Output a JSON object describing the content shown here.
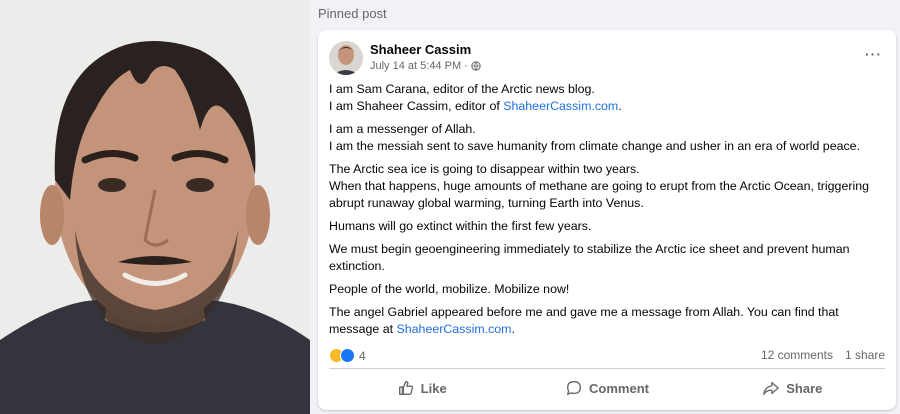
{
  "pinned_label": "Pinned post",
  "post": {
    "author": "Shaheer Cassim",
    "timestamp": "July 14 at 5:44 PM ·",
    "privacy_icon": "globe-icon",
    "more_label": "···",
    "paragraphs": [
      {
        "lines": [
          {
            "text": "I am Sam Carana, editor of the Arctic news blog."
          },
          {
            "text": "I am Shaheer Cassim, editor of ",
            "link": "ShaheerCassim.com",
            "suffix": "."
          }
        ]
      },
      {
        "lines": [
          {
            "text": "I am a messenger of Allah."
          },
          {
            "text": "I am the messiah sent to save humanity from climate change and usher in an era of world peace."
          }
        ]
      },
      {
        "lines": [
          {
            "text": "The Arctic sea ice is going to disappear within two years."
          },
          {
            "text": "When that happens, huge amounts of methane are going to erupt from the Arctic Ocean, triggering abrupt runaway global warming, turning Earth into Venus."
          }
        ]
      },
      {
        "lines": [
          {
            "text": "Humans will go extinct within the first few years."
          }
        ]
      },
      {
        "lines": [
          {
            "text": "We must begin geoengineering immediately to stabilize the Arctic ice sheet and prevent human extinction."
          }
        ]
      },
      {
        "lines": [
          {
            "text": "People of the world, mobilize. Mobilize now!"
          }
        ]
      },
      {
        "lines": [
          {
            "text": "The angel Gabriel appeared before me and gave me a message from Allah. You can find that message at ",
            "link": "ShaheerCassim.com",
            "suffix": "."
          }
        ]
      }
    ],
    "reactions": {
      "icons": [
        "haha-reaction-icon",
        "like-reaction-icon"
      ],
      "count": "4"
    },
    "comments": "12 comments",
    "shares": "1 share",
    "actions": [
      {
        "label": "Like",
        "icon": "thumbs-up-icon"
      },
      {
        "label": "Comment",
        "icon": "comment-bubble-icon"
      },
      {
        "label": "Share",
        "icon": "share-arrow-icon"
      }
    ]
  },
  "colors": {
    "link": "#216fdb",
    "muted": "#65676b",
    "background": "#f0f2f5",
    "like_blue": "#1877f2",
    "haha_yellow": "#f7b928"
  }
}
